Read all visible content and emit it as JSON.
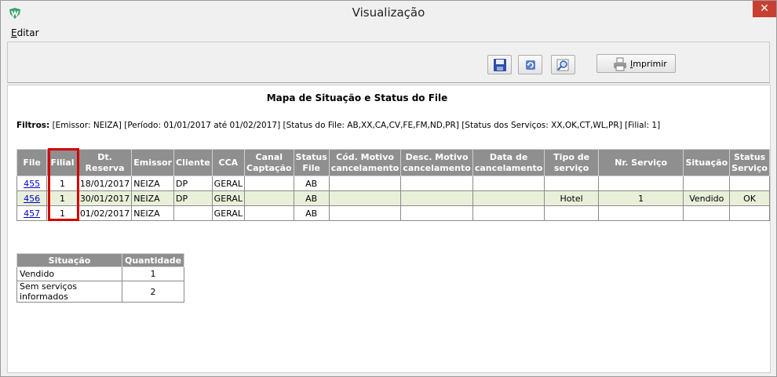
{
  "window": {
    "title": "Visualização",
    "close_glyph": "✕"
  },
  "menu": {
    "items": [
      {
        "label_first": "E",
        "label_rest": "ditar"
      }
    ]
  },
  "toolbar": {
    "save_icon": "save-icon",
    "refresh_icon": "refresh-icon",
    "zoom_icon": "zoom-icon",
    "print_label_first": "I",
    "print_label_rest": "mprimir"
  },
  "report": {
    "title": "Mapa de Situação e Status do File",
    "filters_label": "Filtros:",
    "filters_text": " [Emissor: NEIZA] [Período: 01/01/2017 até 01/02/2017] [Status do File: AB,XX,CA,CV,FE,FM,ND,PR] [Status dos Serviços: XX,OK,CT,WL,PR] [Filial: 1]"
  },
  "table": {
    "headers": [
      "File",
      "Filial",
      "Dt. Reserva",
      "Emissor",
      "Cliente",
      "CCA",
      "Canal Captação",
      "Status File",
      "Cód. Motivo cancelamento",
      "Desc. Motivo cancelamento",
      "Data de cancelamento",
      "Tipo de serviço",
      "Nr. Serviço",
      "Situação",
      "Status Serviço"
    ],
    "rows": [
      [
        "455",
        "1",
        "18/01/2017",
        "NEIZA",
        "DP",
        "GERAL",
        "",
        "AB",
        "",
        "",
        "",
        "",
        "",
        "",
        ""
      ],
      [
        "456",
        "1",
        "30/01/2017",
        "NEIZA",
        "DP",
        "GERAL",
        "",
        "AB",
        "",
        "",
        "",
        "Hotel",
        "1",
        "Vendido",
        "OK"
      ],
      [
        "457",
        "1",
        "01/02/2017",
        "NEIZA",
        "",
        "GERAL",
        "",
        "AB",
        "",
        "",
        "",
        "",
        "",
        "",
        ""
      ]
    ]
  },
  "summary": {
    "headers": [
      "Situação",
      "Quantidade"
    ],
    "rows": [
      [
        "Vendido",
        "1"
      ],
      [
        "Sem serviços informados",
        "2"
      ]
    ]
  },
  "colors": {
    "header_bg": "#8f8f8f",
    "alt_row_bg": "#e9f0da",
    "highlight": "#d40000",
    "close_bg": "#c84031",
    "link": "#0000cc"
  }
}
